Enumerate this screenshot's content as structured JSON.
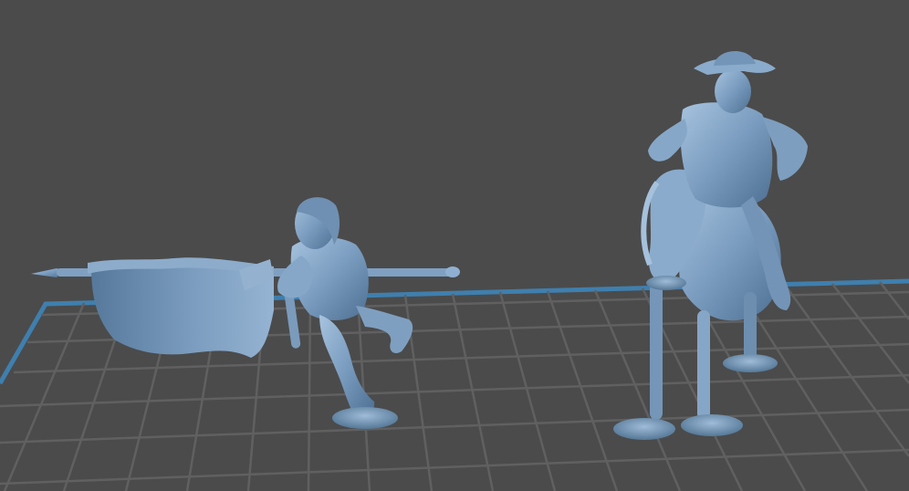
{
  "viewport": {
    "background_color": "#4b4b4b",
    "grid_color": "#5f5f5f",
    "plate_edge_color": "#3f7fae",
    "model_color": "#7a9cbf"
  },
  "models": [
    {
      "name": "running-soldier-with-flag-and-axe"
    },
    {
      "name": "mounted-officer-on-horse"
    }
  ]
}
